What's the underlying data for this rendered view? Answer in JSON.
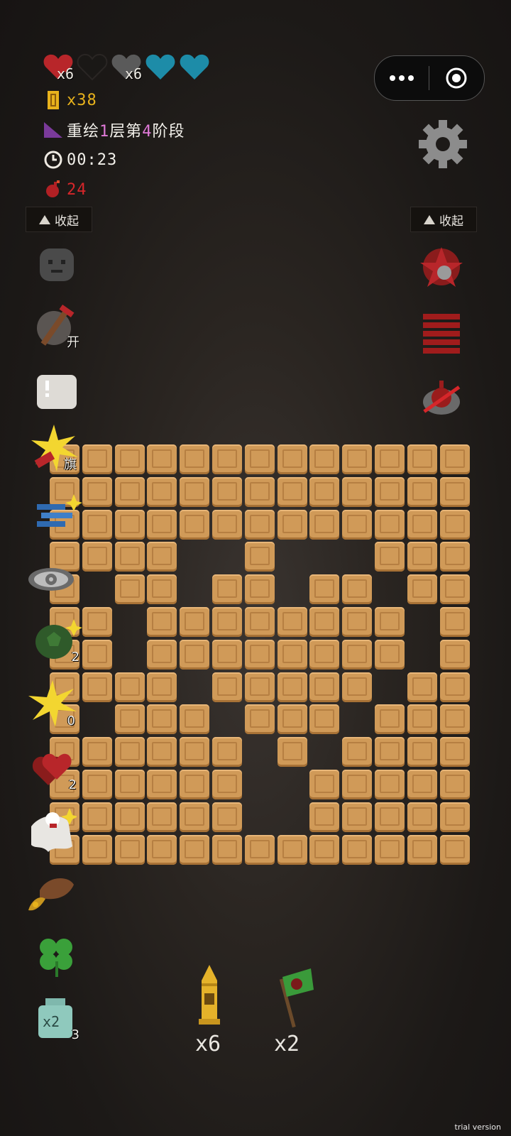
{
  "hud": {
    "hearts": [
      {
        "icon": "red-heart-icon",
        "color": "#b8262a",
        "count": "x6"
      },
      {
        "icon": "black-heart-icon",
        "color": "#1a1816",
        "count": ""
      },
      {
        "icon": "armor-heart-icon",
        "color": "#5a5a5a",
        "count": "x6"
      },
      {
        "icon": "soul-heart-icon",
        "color": "#1d8ca8",
        "count": ""
      },
      {
        "icon": "soul-heart-icon",
        "color": "#1d8ca8",
        "count": ""
      }
    ],
    "coins": "x38",
    "stage_prefix": "重绘",
    "stage_floor": "1",
    "stage_mid": "层第",
    "stage_phase": "4",
    "stage_suffix": "阶段",
    "timer": "00:23",
    "bombs": "24"
  },
  "colors": {
    "tile": "#d09a58",
    "accent_coin": "#e8b21c",
    "accent_bomb": "#d6262a",
    "stage_highlight": "#e07ad8",
    "background": "#1d1a18"
  },
  "left_panel": {
    "collapse_label": "收起",
    "items": [
      {
        "name": "sad-rock-icon",
        "badge": ""
      },
      {
        "name": "pickaxe-shield-icon",
        "badge": "开"
      },
      {
        "name": "blank-card-icon",
        "badge": ""
      },
      {
        "name": "explosion-flag-icon",
        "badge": "旗"
      },
      {
        "name": "blue-wind-icon",
        "badge": ""
      },
      {
        "name": "eye-icon",
        "badge": ""
      },
      {
        "name": "turtle-shell-icon",
        "badge": "2"
      },
      {
        "name": "spark-burst-icon",
        "badge": "0"
      },
      {
        "name": "double-heart-icon",
        "badge": "2"
      },
      {
        "name": "ghost-cloak-icon",
        "badge": ""
      },
      {
        "name": "cornucopia-icon",
        "badge": ""
      },
      {
        "name": "clover-icon",
        "badge": ""
      },
      {
        "name": "x2-jar-icon",
        "badge": "3"
      }
    ]
  },
  "right_panel": {
    "collapse_label": "收起",
    "items": [
      {
        "name": "red-flower-icon"
      },
      {
        "name": "red-stripes-icon"
      },
      {
        "name": "no-bomb-icon"
      }
    ]
  },
  "board": {
    "rows": 13,
    "cols": 13,
    "hidden_cells": [
      [
        3,
        4
      ],
      [
        3,
        5
      ],
      [
        3,
        7
      ],
      [
        3,
        8
      ],
      [
        4,
        4
      ],
      [
        4,
        7
      ],
      [
        4,
        10
      ],
      [
        5,
        2
      ],
      [
        5,
        11
      ],
      [
        6,
        2
      ],
      [
        6,
        11
      ],
      [
        7,
        4
      ],
      [
        7,
        10
      ],
      [
        8,
        5
      ],
      [
        8,
        9
      ],
      [
        9,
        6
      ],
      [
        9,
        8
      ],
      [
        10,
        6
      ],
      [
        10,
        7
      ],
      [
        11,
        6
      ],
      [
        11,
        7
      ],
      [
        5,
        2
      ]
    ],
    "empty_cells": [
      [
        3,
        4
      ],
      [
        3,
        5
      ],
      [
        3,
        7
      ],
      [
        3,
        8
      ],
      [
        3,
        9
      ],
      [
        4,
        1
      ],
      [
        4,
        4
      ],
      [
        4,
        7
      ],
      [
        4,
        10
      ],
      [
        5,
        2
      ],
      [
        5,
        11
      ],
      [
        6,
        2
      ],
      [
        6,
        11
      ],
      [
        7,
        4
      ],
      [
        7,
        10
      ],
      [
        8,
        1
      ],
      [
        8,
        5
      ],
      [
        8,
        9
      ],
      [
        9,
        6
      ],
      [
        9,
        8
      ],
      [
        10,
        6
      ],
      [
        10,
        7
      ],
      [
        11,
        6
      ],
      [
        11,
        7
      ]
    ]
  },
  "bottom": {
    "bullet_count": "x6",
    "flag_count": "x2"
  },
  "watermark": "trial version"
}
